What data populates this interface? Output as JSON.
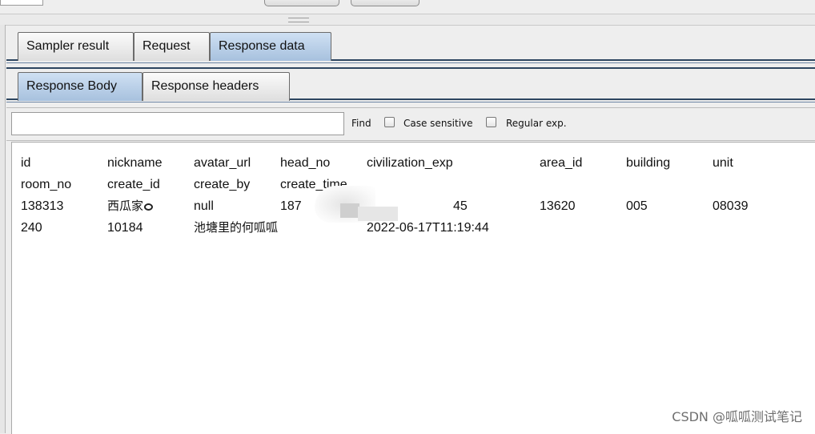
{
  "tabs_top": [
    {
      "label": "Sampler result"
    },
    {
      "label": "Request"
    },
    {
      "label": "Response data"
    }
  ],
  "tabs_sub": [
    {
      "label": "Response Body"
    },
    {
      "label": "Response headers"
    }
  ],
  "find": {
    "label": "Find",
    "value": "",
    "case_sensitive_label": "Case sensitive",
    "regex_label": "Regular exp."
  },
  "response": {
    "rows": [
      [
        "id",
        "nickname",
        "avatar_url",
        "head_no",
        "civilization_exp",
        "area_id",
        "building",
        "unit"
      ],
      [
        "room_no",
        "create_id",
        "create_by",
        "create_time",
        "",
        "",
        "",
        ""
      ],
      [
        "138313",
        "西瓜家",
        "null",
        "187",
        "45",
        "13620",
        "005",
        "08039"
      ],
      [
        "240",
        "10184",
        "池塘里的何呱呱",
        "",
        "2022-06-17T11:19:44",
        "",
        "",
        ""
      ]
    ]
  },
  "watermark": "CSDN @呱呱测试笔记"
}
